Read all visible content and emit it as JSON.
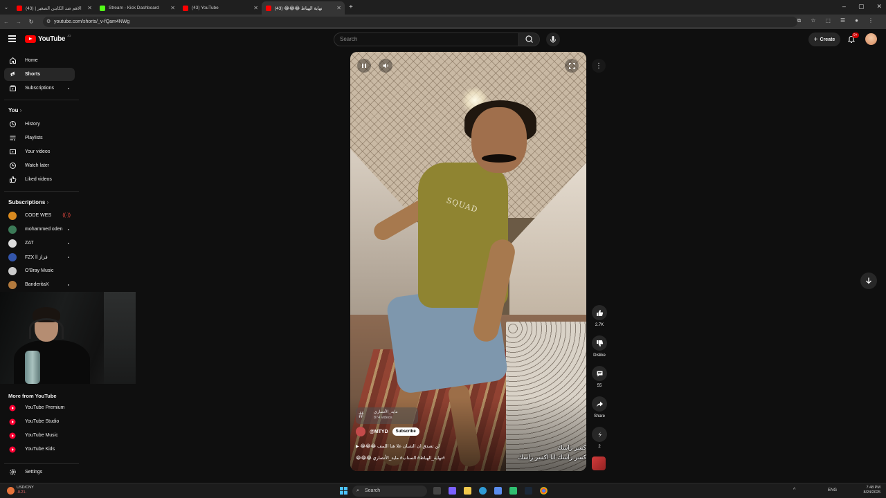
{
  "browser": {
    "tabs": [
      {
        "title": "الاهم ضد الكابتن الصغير | (43)",
        "favicon_color": "#ff0000",
        "active": false
      },
      {
        "title": "Stream - Kick Dashboard",
        "favicon_color": "#53fc18",
        "active": false
      },
      {
        "title": "(43) YouTube",
        "favicon_color": "#ff0000",
        "active": false
      },
      {
        "title": "نهاية الهياط 😂😂😂 (43)",
        "favicon_color": "#ff0000",
        "active": true
      }
    ],
    "new_tab": "+",
    "url": "youtube.com/shorts/_v-fQam4NWg"
  },
  "header": {
    "logo_text": "YouTube",
    "country_code": "JO",
    "search_placeholder": "Search",
    "create_label": "Create",
    "notif_badge": "9+"
  },
  "sidebar": {
    "main": [
      {
        "label": "Home",
        "icon": "home-icon"
      },
      {
        "label": "Shorts",
        "icon": "shorts-icon",
        "selected": true
      },
      {
        "label": "Subscriptions",
        "icon": "subscriptions-icon",
        "dot": true
      }
    ],
    "you_heading": "You",
    "you": [
      {
        "label": "History",
        "icon": "history-icon"
      },
      {
        "label": "Playlists",
        "icon": "playlists-icon"
      },
      {
        "label": "Your videos",
        "icon": "your-videos-icon"
      },
      {
        "label": "Watch later",
        "icon": "watch-later-icon"
      },
      {
        "label": "Liked videos",
        "icon": "liked-videos-icon"
      }
    ],
    "subs_heading": "Subscriptions",
    "subscriptions": [
      {
        "label": "CODE WES",
        "color": "#d98a1f",
        "live": true
      },
      {
        "label": "mohammed oden",
        "color": "#3b7a57",
        "dot": true
      },
      {
        "label": "ZAT",
        "color": "#dddddd",
        "dot": true
      },
      {
        "label": "FZX ll فزاز",
        "color": "#3355aa",
        "dot": true
      },
      {
        "label": "O'Bray Music",
        "color": "#cccccc"
      },
      {
        "label": "BanderitaX",
        "color": "#b37a3d",
        "dot": true
      }
    ],
    "more_heading": "More from YouTube",
    "more": [
      {
        "label": "YouTube Premium"
      },
      {
        "label": "YouTube Studio"
      },
      {
        "label": "YouTube Music"
      },
      {
        "label": "YouTube Kids"
      }
    ],
    "settings_label": "Settings"
  },
  "video": {
    "shirt_text": "SQUAD",
    "hashtag_name": "مايد_الأنصاري",
    "hashtag_count": "874 videos",
    "channel": "@MTYD",
    "subscribe_label": "Subscribe",
    "title": "😂😂😂 لن تصدق ان الشبان علا هنا اللمف",
    "tags": "😂😂😂 نهاية_الهياط# السناب# مايد_الأنصاري#",
    "caption1": "كسر راسك",
    "caption2": "كسر راسك انا اكسر راسك"
  },
  "actions": {
    "likes": "2.7K",
    "dislike_label": "Dislike",
    "comments": "55",
    "share_label": "Share",
    "remix": "2"
  },
  "taskbar": {
    "search_label": "Search",
    "stock_name": "USD/CNY",
    "stock_change": "-0.21-",
    "lang": "ENG",
    "time": "7:48 PM",
    "date": "8/24/2025"
  }
}
